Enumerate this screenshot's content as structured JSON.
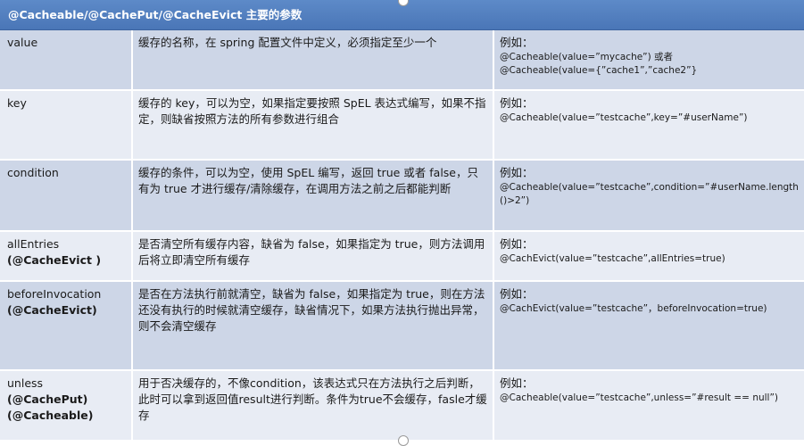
{
  "header": {
    "title": "@Cacheable/@CachePut/@CacheEvict 主要的参数"
  },
  "rows": [
    {
      "name": "value",
      "annotations": [],
      "description": "缓存的名称，在 spring 配置文件中定义，必须指定至少一个",
      "example_label": "例如：",
      "example_lines": [
        "@Cacheable(value=”mycache”) 或者",
        "@Cacheable(value={”cache1”,”cache2”}"
      ]
    },
    {
      "name": "key",
      "annotations": [],
      "description": "缓存的 key，可以为空，如果指定要按照 SpEL 表达式编写，如果不指定，则缺省按照方法的所有参数进行组合",
      "example_label": "例如：",
      "example_lines": [
        "@Cacheable(value=”testcache”,key=”#userName”)"
      ]
    },
    {
      "name": "condition",
      "annotations": [],
      "description": "缓存的条件，可以为空，使用 SpEL 编写，返回 true 或者 false，只有为 true 才进行缓存/清除缓存，在调用方法之前之后都能判断",
      "example_label": "例如：",
      "example_lines": [
        "@Cacheable(value=”testcache”,condition=”#userName.length()>2”)"
      ]
    },
    {
      "name": "allEntries",
      "annotations": [
        "(@CacheEvict )"
      ],
      "description": "是否清空所有缓存内容，缺省为 false，如果指定为 true，则方法调用后将立即清空所有缓存",
      "example_label": "例如：",
      "example_lines": [
        "@CachEvict(value=”testcache”,allEntries=true)"
      ]
    },
    {
      "name": "beforeInvocation",
      "annotations": [
        "(@CacheEvict)"
      ],
      "description": "是否在方法执行前就清空，缺省为 false，如果指定为 true，则在方法还没有执行的时候就清空缓存，缺省情况下，如果方法执行抛出异常，则不会清空缓存",
      "example_label": "例如：",
      "example_lines": [
        "@CachEvict(value=”testcache”，beforeInvocation=true)"
      ]
    },
    {
      "name": "unless",
      "annotations": [
        "(@CachePut)",
        "(@Cacheable)"
      ],
      "description": "用于否决缓存的，不像condition，该表达式只在方法执行之后判断，此时可以拿到返回值result进行判断。条件为true不会缓存，fasle才缓存",
      "example_label": "例如：",
      "example_lines": [
        "@Cacheable(value=”testcache”,unless=”#result == null”)"
      ]
    }
  ]
}
